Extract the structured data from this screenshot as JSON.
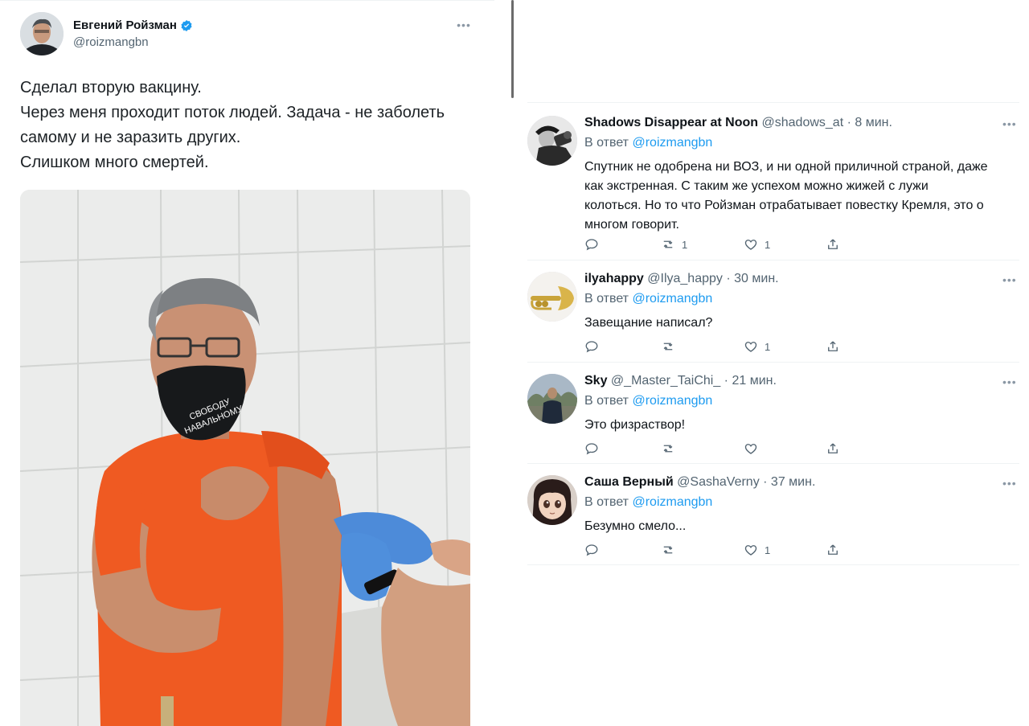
{
  "main_tweet": {
    "author_name": "Евгений Ройзман",
    "author_handle": "@roizmangbn",
    "more_icon": "more-icon",
    "lines": [
      "Сделал вторую вакцину.",
      "Через меня проходит поток людей. Задача - не заболеть",
      "самому и не заразить других.",
      "Слишком много смертей."
    ],
    "mask_text_1": "СВОБОДУ",
    "mask_text_2": "НАВАЛЬНОМУ"
  },
  "replies": [
    {
      "name": "Shadows Disappear at Noon",
      "handle": "@shadows_at",
      "time": "· 8 мин.",
      "reply_to_prefix": "В ответ",
      "reply_to_mention": "@roizmangbn",
      "lines": [
        "Спутник не одобрена ни ВОЗ, и ни одной приличной страной, даже",
        "как экстренная. С таким же успехом можно жижей с лужи",
        "колоться. Но то что Ройзман отрабатывает повестку Кремля, это о",
        "многом говорит."
      ],
      "reply_count": "",
      "retweet_count": "1",
      "like_count": "1"
    },
    {
      "name": "ilyahappy",
      "handle": "@Ilya_happy",
      "time": "· 30 мин.",
      "reply_to_prefix": "В ответ",
      "reply_to_mention": "@roizmangbn",
      "lines": [
        "Завещание написал?"
      ],
      "reply_count": "",
      "retweet_count": "",
      "like_count": "1"
    },
    {
      "name": "Sky",
      "handle": "@_Master_TaiChi_",
      "time": "· 21 мин.",
      "reply_to_prefix": "В ответ",
      "reply_to_mention": "@roizmangbn",
      "lines": [
        "Это физраствор!"
      ],
      "reply_count": "",
      "retweet_count": "",
      "like_count": ""
    },
    {
      "name": "Саша Верный",
      "handle": "@SashaVerny",
      "time": "· 37 мин.",
      "reply_to_prefix": "В ответ",
      "reply_to_mention": "@roizmangbn",
      "lines": [
        "Безумно смело..."
      ],
      "reply_count": "",
      "retweet_count": "",
      "like_count": "1"
    }
  ],
  "colors": {
    "link": "#1d9bf0",
    "secondary_text": "#536471",
    "verified": "#1d9bf0"
  }
}
